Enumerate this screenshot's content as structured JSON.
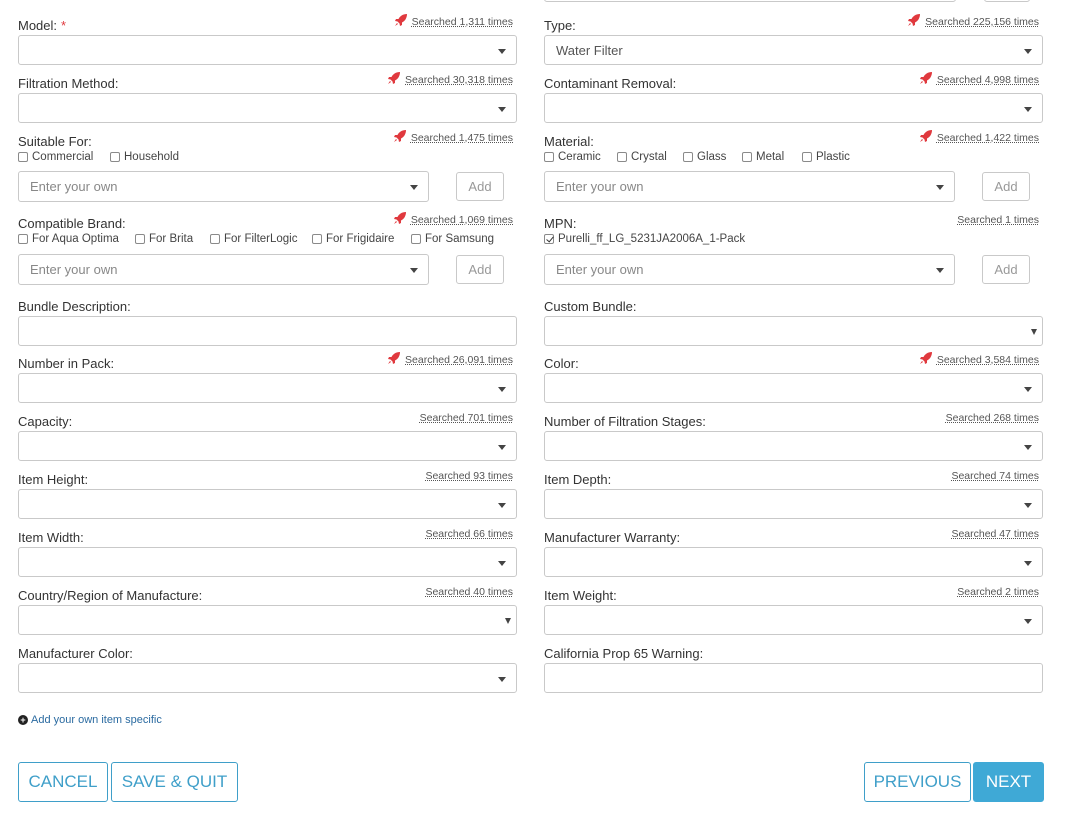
{
  "fields": {
    "model": {
      "label": "Model:",
      "required_mark": "*",
      "searched": "Searched 1,311 times",
      "value": ""
    },
    "type": {
      "label": "Type:",
      "searched": "Searched 225,156 times",
      "value": "Water Filter"
    },
    "filtration_method": {
      "label": "Filtration Method:",
      "searched": "Searched 30,318 times"
    },
    "contaminant_removal": {
      "label": "Contaminant Removal:",
      "searched": "Searched 4,998 times"
    },
    "suitable_for": {
      "label": "Suitable For:",
      "searched": "Searched 1,475 times",
      "options": [
        "Commercial",
        "Household"
      ],
      "placeholder": "Enter your own",
      "add_label": "Add"
    },
    "material": {
      "label": "Material:",
      "searched": "Searched 1,422 times",
      "options": [
        "Ceramic",
        "Crystal",
        "Glass",
        "Metal",
        "Plastic"
      ],
      "placeholder": "Enter your own",
      "add_label": "Add"
    },
    "compatible_brand": {
      "label": "Compatible Brand:",
      "searched": "Searched 1,069 times",
      "options": [
        "For Aqua Optima",
        "For Brita",
        "For FilterLogic",
        "For Frigidaire",
        "For Samsung"
      ],
      "placeholder": "Enter your own",
      "add_label": "Add"
    },
    "mpn": {
      "label": "MPN:",
      "searched": "Searched 1 times",
      "options": [
        "Purelli_ff_LG_5231JA2006A_1-Pack"
      ],
      "checked": [
        true
      ],
      "placeholder": "Enter your own",
      "add_label": "Add"
    },
    "bundle_description": {
      "label": "Bundle Description:"
    },
    "custom_bundle": {
      "label": "Custom Bundle:"
    },
    "number_in_pack": {
      "label": "Number in Pack:",
      "searched": "Searched 26,091 times"
    },
    "color": {
      "label": "Color:",
      "searched": "Searched 3,584 times"
    },
    "capacity": {
      "label": "Capacity:",
      "searched": "Searched 701 times"
    },
    "filtration_stages": {
      "label": "Number of Filtration Stages:",
      "searched": "Searched 268 times"
    },
    "item_height": {
      "label": "Item Height:",
      "searched": "Searched 93 times"
    },
    "item_depth": {
      "label": "Item Depth:",
      "searched": "Searched 74 times"
    },
    "item_width": {
      "label": "Item Width:",
      "searched": "Searched 66 times"
    },
    "manufacturer_warranty": {
      "label": "Manufacturer Warranty:",
      "searched": "Searched 47 times"
    },
    "country": {
      "label": "Country/Region of Manufacture:",
      "searched": "Searched 40 times"
    },
    "item_weight": {
      "label": "Item Weight:",
      "searched": "Searched 2 times"
    },
    "manufacturer_color": {
      "label": "Manufacturer Color:"
    },
    "california_prop65": {
      "label": "California Prop 65 Warning:"
    }
  },
  "add_item_specific": "Add your own item specific",
  "buttons": {
    "cancel": "CANCEL",
    "save_quit": "SAVE & QUIT",
    "previous": "PREVIOUS",
    "next": "NEXT"
  },
  "colors": {
    "accent": "#3fa9d6",
    "rocket": "#e0393e",
    "required": "#e0393e"
  },
  "icons": {
    "popular": "rocket-icon",
    "add": "plus-circle-icon",
    "dropdown": "chevron-down-icon"
  }
}
